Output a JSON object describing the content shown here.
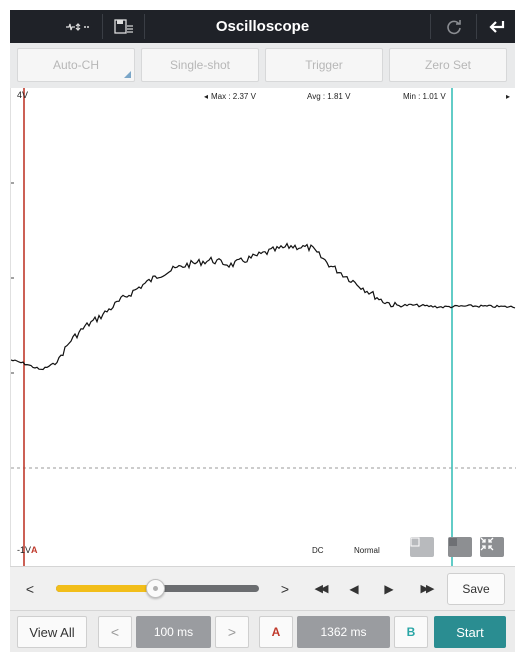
{
  "header": {
    "title": "Oscilloscope",
    "left_icons": [
      "channel-toggle-icon",
      "save-file-icon"
    ],
    "right_icons": [
      "refresh-icon",
      "back-arrow-icon"
    ]
  },
  "modes": [
    {
      "label": "Auto-CH",
      "name": "auto-ch-button"
    },
    {
      "label": "Single-shot",
      "name": "single-shot-button"
    },
    {
      "label": "Trigger",
      "name": "trigger-button"
    },
    {
      "label": "Zero Set",
      "name": "zero-set-button"
    }
  ],
  "scope": {
    "y_top_label": "4V",
    "y_bottom_label": "-1V",
    "cursor_a_marker": "A",
    "stats": {
      "max": "Max : 2.37 V",
      "avg": "Avg : 1.81 V",
      "min": "Min : 1.01 V"
    },
    "coupling": "DC",
    "trigger_mode": "Normal",
    "cursor_a_color": "#c0392b",
    "cursor_b_color": "#3bbfb9",
    "corner_buttons": [
      "grid-icon",
      "stop-icon",
      "shrink-icon"
    ]
  },
  "nav": {
    "slider_position": 0.49,
    "slider_color": "#f2be1a",
    "prev_glyph": "<",
    "next_glyph": ">",
    "rewind_glyph": "◀◀",
    "step_back_glyph": "◀",
    "play_glyph": "▶",
    "fast_forward_glyph": "▶▶",
    "save_label": "Save"
  },
  "bottom": {
    "view_all_label": "View All",
    "time_prev_glyph": "<",
    "timebase": "100 ms",
    "time_next_glyph": ">",
    "cursor_a_label": "A",
    "cursor_delta": "1362 ms",
    "cursor_b_label": "B",
    "start_label": "Start"
  }
}
